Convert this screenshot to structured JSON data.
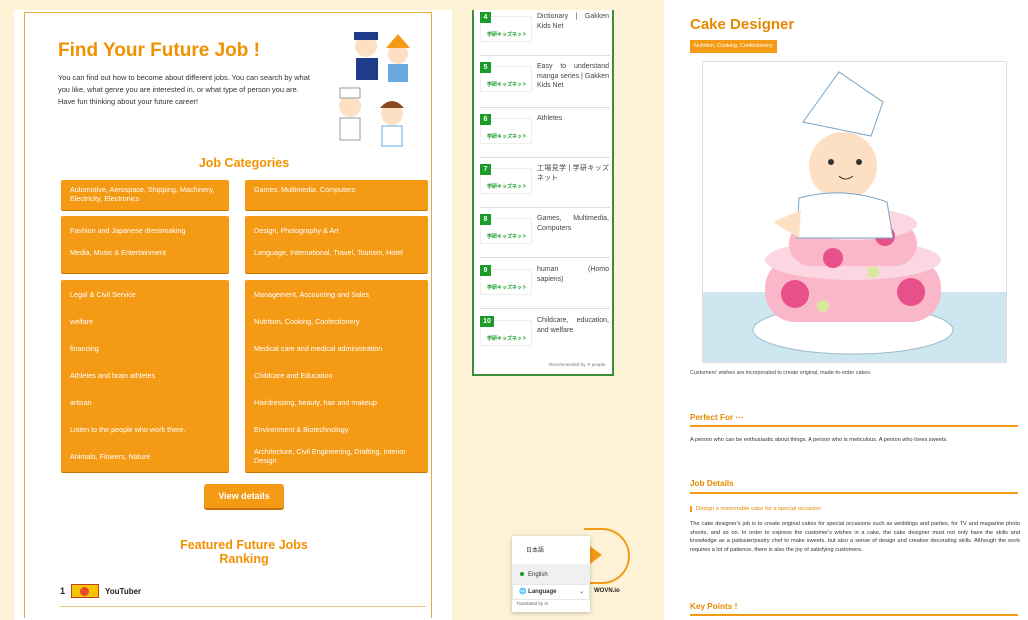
{
  "left": {
    "title": "Find Your Future Job !",
    "intro": "You can find out how to become about different jobs. You can search by what you like, what genre you are interested in, or what type of person you are. Have fun thinking about your future career!",
    "categories_heading": "Job Categories",
    "categories": [
      "Automotive, Aerospace, Shipping, Machinery, Electricity, Electronics",
      "Games, Multimedia, Computers",
      "Fashion and Japanese dressmaking",
      "Design, Photography & Art",
      "Media, Music & Entertainment",
      "Language, International, Travel, Tourism, Hotel",
      "Legal & Civil Service",
      "Management, Accounting and Sales",
      "welfare",
      "Nutrition, Cooking, Confectionery",
      "financing",
      "Medical care and medical administration",
      "Athletes and brain athletes",
      "Childcare and Education",
      "artisan",
      "Hairdressing, beauty, hair and makeup",
      "Listen to the people who work there.",
      "Environment & Biotechnology",
      "Animals, Flowers, Nature",
      "Architecture, Civil Engineering, Drafting, Interior Design"
    ],
    "view_details": "View details",
    "ranking_heading_1": "Featured Future Jobs",
    "ranking_heading_2": "Ranking",
    "rank1_num": "1",
    "rank1_label": "YouTuber"
  },
  "middle": {
    "items": [
      {
        "num": "4",
        "text": "Dictionary | Gakken Kids Net"
      },
      {
        "num": "5",
        "text": "Easy to understand manga series | Gakken Kids Net"
      },
      {
        "num": "6",
        "text": "Athletes"
      },
      {
        "num": "7",
        "text": "工場見学 | 学研キッズネット"
      },
      {
        "num": "8",
        "text": "Games, Multimedia, Computers"
      },
      {
        "num": "9",
        "text": "human (Homo sapiens)"
      },
      {
        "num": "10",
        "text": "Childcare, education, and welfare"
      }
    ],
    "logo_text": "学研キッズネット",
    "recommended": "Recommended by  ✕ people"
  },
  "lang_popover": {
    "option_ja": "日本語",
    "option_en": "English",
    "selector": "Language",
    "translated_by": "Translated by AI",
    "brand": "WOVN.io"
  },
  "right": {
    "title": "Cake Designer",
    "tag": "Nutrition, Cooking, Confectionery",
    "caption": "Customers' wishes are incorporated to create original, made-to-order cakes.",
    "perfect_for_heading": "Perfect For ···",
    "perfect_for_text": "A person who can be enthusiastic about things. A person who is meticulous. A person who loves sweets.",
    "job_details_heading": "Job Details",
    "job_details_sub": "Design a memorable cake for a special occasion",
    "job_details_text": "The cake designer's job is to create original cakes for special occasions such as weddings and parties, for TV and magazine photo shoots, and so on. In order to express the customer's wishes in a cake, the cake designer must not only have the skills and knowledge as a patissier/pastry chef to make sweets, but also a sense of design and creative decorating skills. Although the work requires a lot of patience, there is also the joy of satisfying customers.",
    "key_points_heading": "Key Points !"
  },
  "colors": {
    "accent": "#f49a15",
    "heading": "#f29100",
    "green": "#1b9b29",
    "page_bg": "#fdf1d6"
  }
}
